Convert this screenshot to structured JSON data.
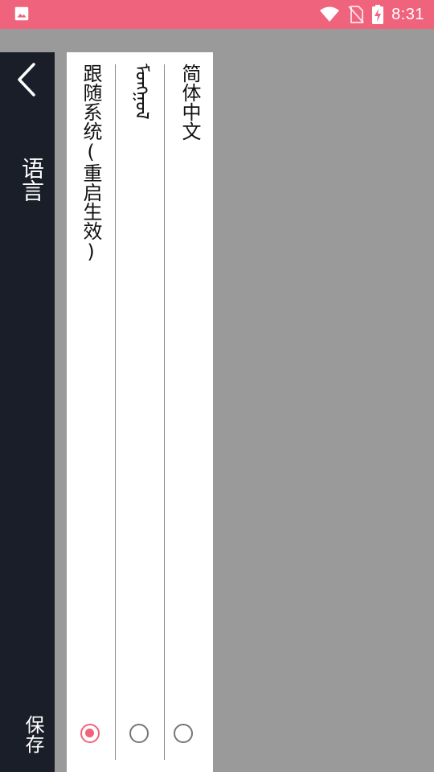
{
  "status_bar": {
    "time": "8:31",
    "icons": [
      "image-icon",
      "wifi-icon",
      "no-sim-icon",
      "battery-charging-icon"
    ],
    "background_color": "#f0637c"
  },
  "header": {
    "title": "语言",
    "back_icon": "chevron-left-icon",
    "save_label": "保存",
    "background_color": "#1a1e29"
  },
  "options": [
    {
      "label": "跟随系统(重启生效)",
      "selected": true
    },
    {
      "label": "ᠮᠣᠩᠭᠣᠯ",
      "selected": false
    },
    {
      "label": "简体中文",
      "selected": false
    }
  ],
  "accent_color": "#f0637c"
}
